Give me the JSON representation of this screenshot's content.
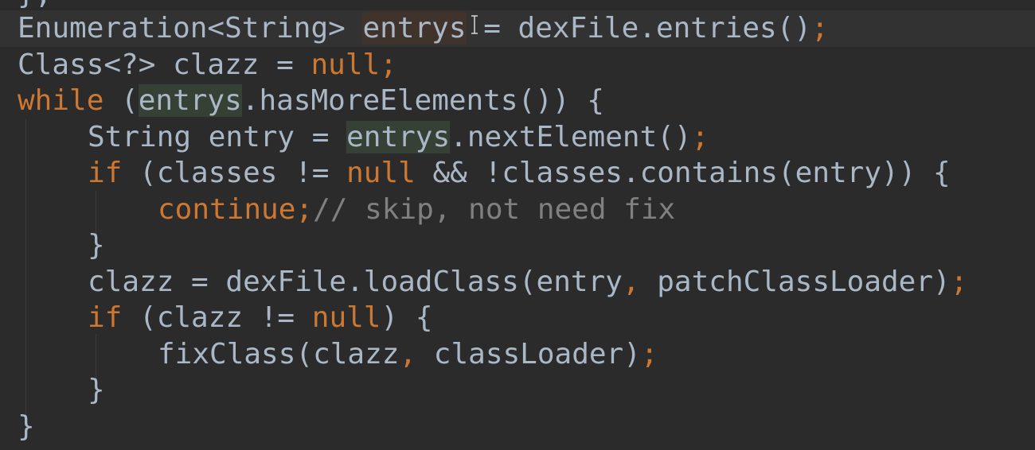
{
  "code": {
    "partial_top": "};",
    "l1": {
      "a": "Enumeration<String> ",
      "b": "entrys",
      "c": " = dexFile.entries()",
      "d": ";"
    },
    "l2": {
      "a": "Class<?> clazz = ",
      "b": "null",
      "c": ";"
    },
    "l3": {
      "a": "while",
      "b": " (",
      "c": "entrys",
      "d": ".hasMoreElements()) {"
    },
    "l4": {
      "a": "String entry = ",
      "b": "entrys",
      "c": ".nextElement()",
      "d": ";"
    },
    "l5": {
      "a": "if",
      "b": " (classes != ",
      "c": "null",
      "d": " && !classes.contains(entry)) {"
    },
    "l6": {
      "a": "continue",
      "b": ";",
      "c": "// skip, not need fix"
    },
    "l7": {
      "a": "}"
    },
    "l8": {
      "a": "clazz = dexFile.loadClass(entry",
      "b": ",",
      "c": " patchClassLoader)",
      "d": ";"
    },
    "l9": {
      "a": "if",
      "b": " (clazz != ",
      "c": "null",
      "d": ") {"
    },
    "l10": {
      "a": "fixClass(clazz",
      "b": ",",
      "c": " classLoader)",
      "d": ";"
    },
    "l11": {
      "a": "}"
    },
    "l12": {
      "a": "}"
    }
  },
  "colors": {
    "background": "#2b2b2b",
    "text": "#a9b7c6",
    "keyword": "#cc7832",
    "comment": "#808080",
    "highlight": "#344134"
  },
  "cursor_icon": "text-cursor-icon"
}
